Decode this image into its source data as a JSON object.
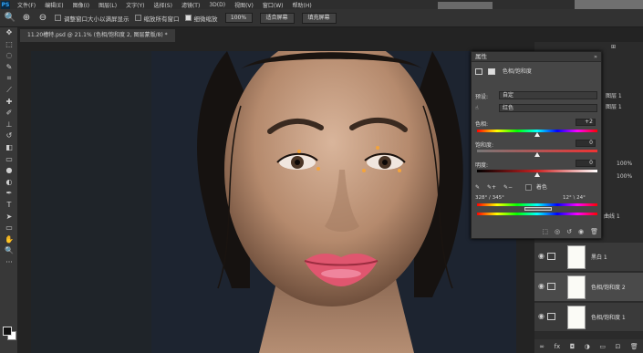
{
  "menubar": {
    "logo": "PS",
    "items": [
      "文件(F)",
      "编辑(E)",
      "图像(I)",
      "图层(L)",
      "文字(Y)",
      "选择(S)",
      "滤镜(T)",
      "3D(D)",
      "视图(V)",
      "窗口(W)",
      "帮助(H)"
    ]
  },
  "options": {
    "resize_label": "调整窗口大小以满屏显示",
    "zoom_all_label": "缩放所有窗口",
    "scrubby_label": "细微缩放",
    "zoom_value": "100%",
    "fit_screen": "适合屏幕",
    "fill_screen": "填充屏幕"
  },
  "document": {
    "tab_title": "11.20槽特.psd @ 21.1% (色相/饱和度 2, 图层蒙版/8) *"
  },
  "properties": {
    "title": "属性",
    "close": "»",
    "adjustment_name": "色相/饱和度",
    "preset_label": "预设:",
    "preset_value": "自定",
    "channel_value": "红色",
    "hue_label": "色相:",
    "hue_value": "+2",
    "saturation_label": "饱和度:",
    "saturation_value": "0",
    "lightness_label": "明度:",
    "lightness_value": "0",
    "colorize_label": "着色",
    "range_left": "328° / 345°",
    "range_right": "12° \\ 24°"
  },
  "layers": {
    "items": [
      {
        "name": "黑白 1"
      },
      {
        "name": "色相/饱和度 2"
      },
      {
        "name": "色相/饱和度 1"
      }
    ],
    "opacity": "100%",
    "fill": "100%",
    "partial_label_1": "图层 1",
    "partial_label_2": "图层 1",
    "partial_label_3": "曲线 1"
  },
  "colors": {
    "accent_lips": "#e0566f",
    "skin": "#c9a083",
    "background": "#1d2430"
  }
}
